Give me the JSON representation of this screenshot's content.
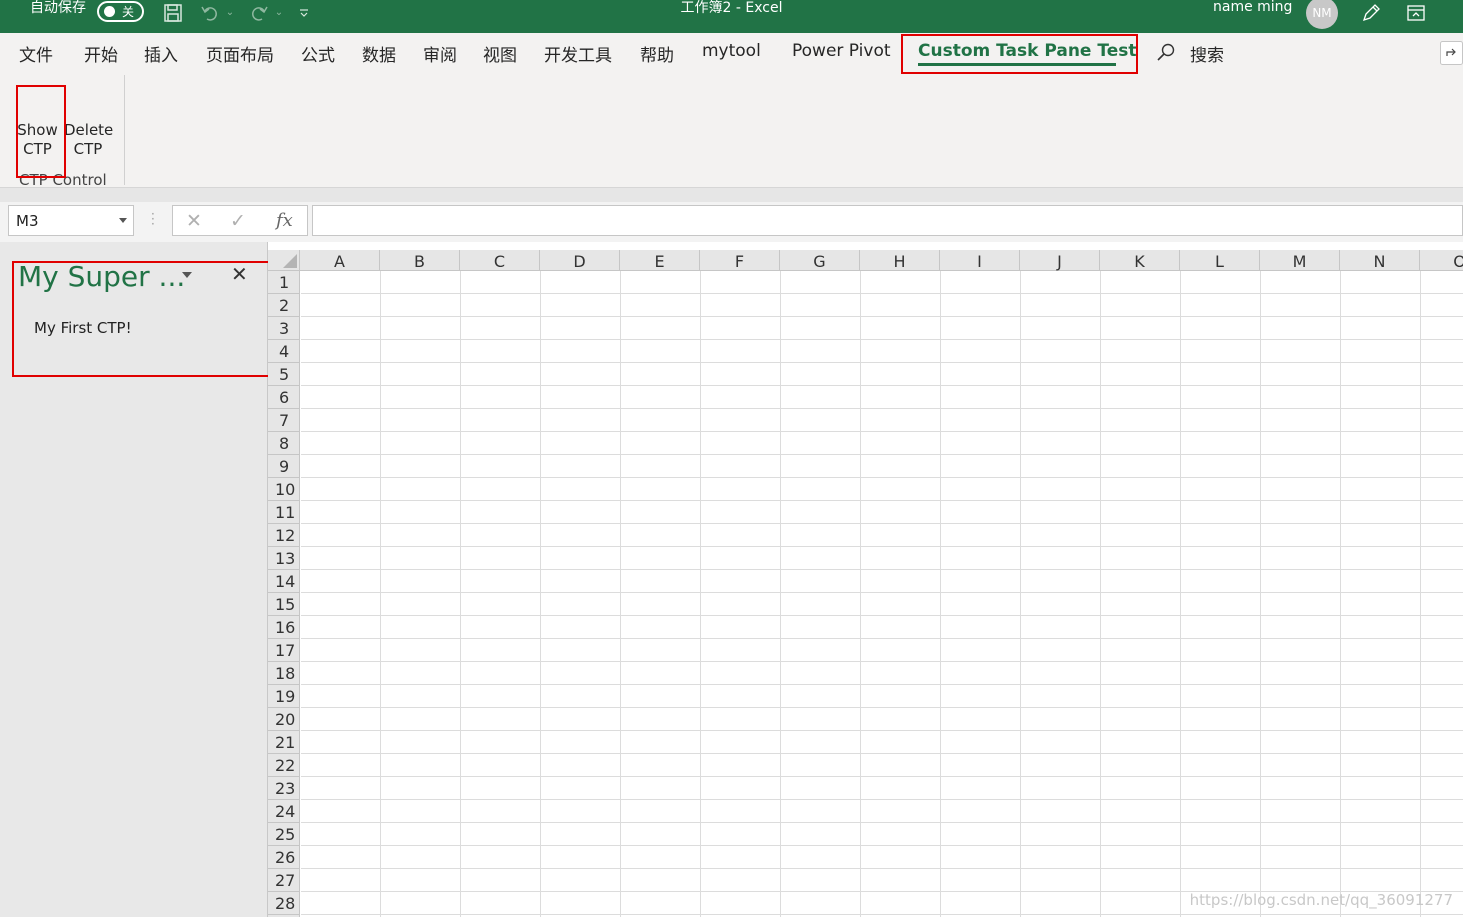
{
  "title_bar": {
    "autosave_label": "自动保存",
    "autosave_state": "关",
    "document_title": "工作簿2  -  Excel",
    "user_name": "name ming",
    "user_initials": "NM"
  },
  "ribbon_tabs": [
    {
      "label": "文件"
    },
    {
      "label": "开始"
    },
    {
      "label": "插入"
    },
    {
      "label": "页面布局"
    },
    {
      "label": "公式"
    },
    {
      "label": "数据"
    },
    {
      "label": "审阅"
    },
    {
      "label": "视图"
    },
    {
      "label": "开发工具"
    },
    {
      "label": "帮助"
    },
    {
      "label": "mytool"
    },
    {
      "label": "Power Pivot"
    },
    {
      "label": "Custom Task Pane Test",
      "active": true
    }
  ],
  "search": {
    "label": "搜索"
  },
  "ribbon": {
    "show_ctp_line1": "Show",
    "show_ctp_line2": "CTP",
    "delete_ctp_line1": "Delete",
    "delete_ctp_line2": "CTP",
    "group_label": "CTP Control"
  },
  "formula_bar": {
    "name_box": "M3",
    "formula": ""
  },
  "task_pane": {
    "title": "My Super ...",
    "content": "My First CTP!"
  },
  "grid": {
    "columns": [
      "A",
      "B",
      "C",
      "D",
      "E",
      "F",
      "G",
      "H",
      "I",
      "J",
      "K",
      "L",
      "M",
      "N",
      "O"
    ],
    "rows": [
      "1",
      "2",
      "3",
      "4",
      "5",
      "6",
      "7",
      "8",
      "9",
      "10",
      "11",
      "12",
      "13",
      "14",
      "15",
      "16",
      "17",
      "18",
      "19",
      "20",
      "21",
      "22",
      "23",
      "24",
      "25",
      "26",
      "27",
      "28"
    ]
  },
  "watermark": "https://blog.csdn.net/qq_36091277",
  "colors": {
    "accent": "#217346",
    "highlight": "#e00000"
  }
}
